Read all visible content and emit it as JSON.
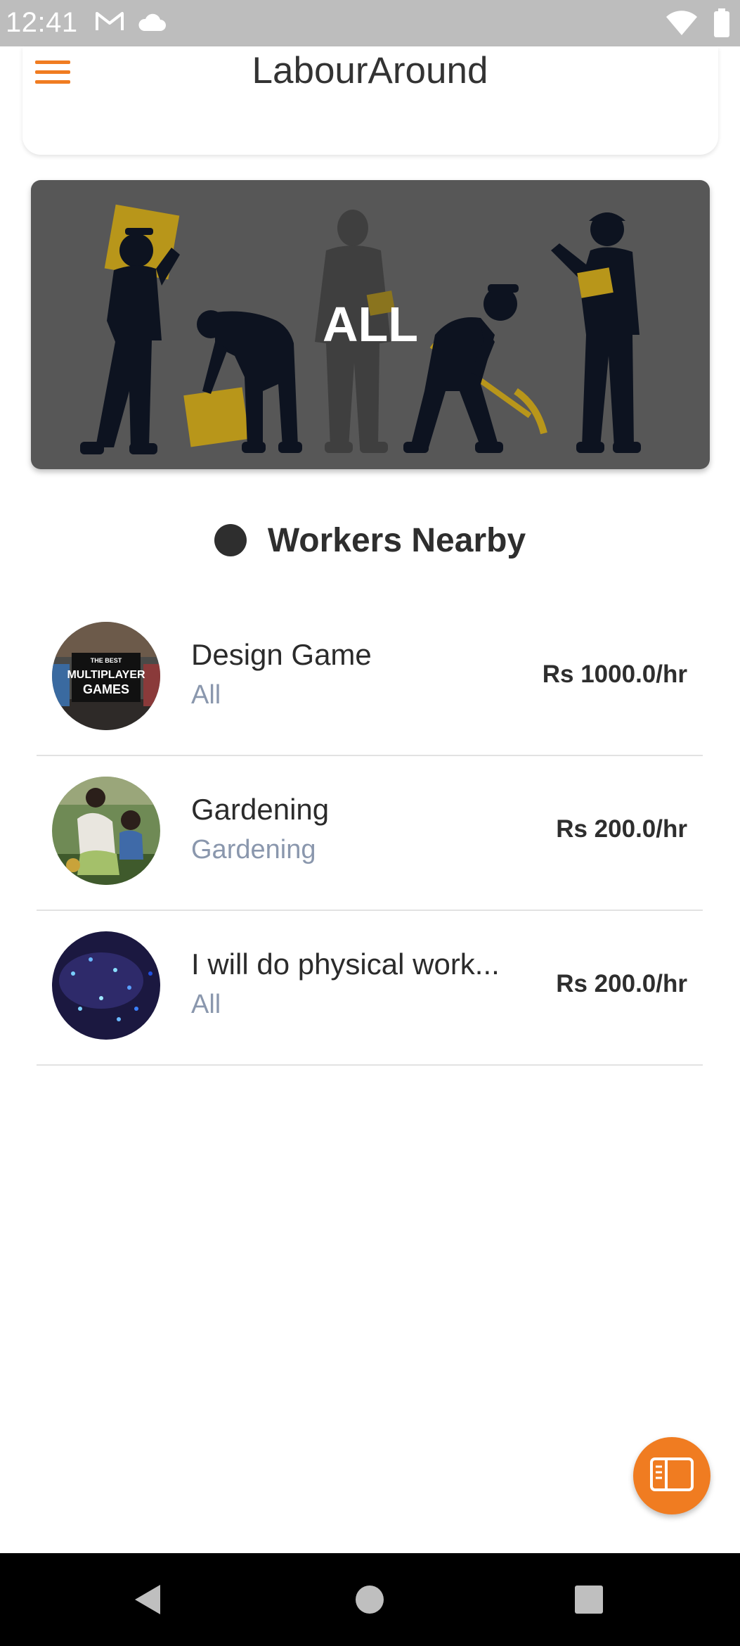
{
  "status_bar": {
    "time": "12:41",
    "icons": [
      "gmail-icon",
      "cloud-icon",
      "wifi-icon",
      "battery-icon"
    ]
  },
  "app_bar": {
    "title": "LabourAround",
    "menu_icon": "hamburger-menu-icon"
  },
  "banner": {
    "label": "ALL"
  },
  "section": {
    "title": "Workers Nearby"
  },
  "workers": [
    {
      "name": "Design Game",
      "category": "All",
      "rate": "Rs 1000.0/hr",
      "avatar_text": [
        "THE BEST",
        "MULTIPLAYER",
        "GAMES"
      ]
    },
    {
      "name": "Gardening",
      "category": "Gardening",
      "rate": "Rs 200.0/hr"
    },
    {
      "name": "I will do physical work...",
      "category": "All",
      "rate": "Rs 200.0/hr"
    }
  ],
  "fab": {
    "icon": "sidebar-panel-icon"
  },
  "nav_bar": {
    "icons": [
      "back-icon",
      "home-icon",
      "recents-icon"
    ]
  },
  "colors": {
    "accent": "#f07c21",
    "status_bar": "#bdbdbd",
    "banner_bg": "#575757",
    "category_text": "#8a97ad",
    "divider": "#e2e2e2"
  }
}
